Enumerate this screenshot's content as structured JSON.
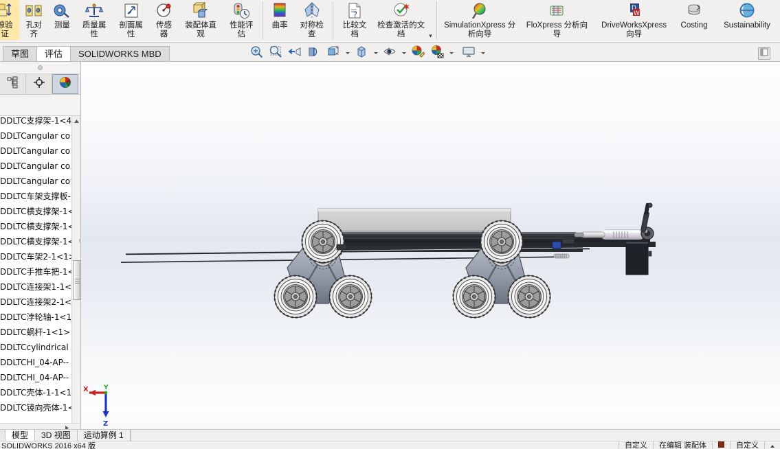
{
  "app": {
    "version_text": "SOLIDWORKS 2016 x64 版"
  },
  "ribbon": {
    "groups": [
      {
        "items": [
          {
            "label": "隙验证",
            "icon": "clearance-verification-icon",
            "truncated": true
          },
          {
            "label": "孔对齐",
            "icon": "hole-alignment-icon"
          },
          {
            "label": "测量",
            "icon": "measure-icon"
          },
          {
            "label": "质量属性",
            "icon": "mass-properties-icon"
          },
          {
            "label": "剖面属性",
            "icon": "section-properties-icon"
          },
          {
            "label": "传感器",
            "icon": "sensor-icon"
          },
          {
            "label": "装配体直观",
            "icon": "assembly-visualization-icon"
          },
          {
            "label": "性能评估",
            "icon": "performance-evaluation-icon"
          }
        ]
      },
      {
        "items": [
          {
            "label": "曲率",
            "icon": "curvature-icon"
          },
          {
            "label": "对称检查",
            "icon": "symmetry-check-icon"
          }
        ]
      },
      {
        "items": [
          {
            "label": "比较文档",
            "icon": "compare-documents-icon"
          },
          {
            "label": "检查激活的文档",
            "icon": "check-active-document-icon",
            "has_more": true
          }
        ]
      },
      {
        "items": [
          {
            "label": "SimulationXpress 分析向导",
            "icon": "simulationxpress-icon",
            "wide": true
          },
          {
            "label": "FloXpress 分析向导",
            "icon": "floxpress-icon",
            "wide": true
          },
          {
            "label": "DriveWorksXpress 向导",
            "icon": "driveworksxpress-icon",
            "wide": true
          },
          {
            "label": "Costing",
            "icon": "costing-icon",
            "wide": true
          },
          {
            "label": "Sustainability",
            "icon": "sustainability-icon",
            "wide": true
          }
        ]
      }
    ]
  },
  "command_tabs": [
    {
      "label": "草图",
      "active": false
    },
    {
      "label": "评估",
      "active": true
    },
    {
      "label": "SOLIDWORKS MBD",
      "active": false
    }
  ],
  "hud_toolbar": {
    "buttons": [
      {
        "name": "zoom-to-fit-icon",
        "caret": false
      },
      {
        "name": "zoom-to-area-icon",
        "caret": false
      },
      {
        "name": "previous-view-icon",
        "caret": false
      },
      {
        "name": "section-view-icon",
        "caret": false
      },
      {
        "name": "view-orientation-icon",
        "caret": false
      },
      {
        "name": "display-style-icon",
        "caret": true
      },
      {
        "name": "hide-show-items-icon",
        "caret": true
      },
      {
        "name": "edit-appearance-icon",
        "caret": false
      },
      {
        "name": "apply-scene-icon",
        "caret": true
      },
      {
        "name": "view-settings-icon",
        "caret": true
      }
    ],
    "collapse_panel": "collapse-panel-icon"
  },
  "left_panel": {
    "tabs": [
      {
        "name": "feature-manager-tab",
        "icon": "feature-tree-icon",
        "active": false
      },
      {
        "name": "property-manager-tab",
        "icon": "crosshair-icon",
        "active": false
      },
      {
        "name": "display-manager-tab",
        "icon": "color-sphere-icon",
        "active": true
      }
    ],
    "tree_nodes": [
      "DDLTC支撑架-1<4",
      "DDLTCangular co",
      "DDLTCangular co",
      "DDLTCangular co",
      "DDLTCangular co",
      "DDLTC车架支撑板-",
      "DDLTC横支撑架-1<",
      "DDLTC横支撑架-1<",
      "DDLTC横支撑架-1<",
      "DDLTC车架2-1<1>",
      "DDLTC手推车把-1<",
      "DDLTC连接架1-1<",
      "DDLTC连接架2-1<",
      "DDLTC浡轮轴-1<1",
      "DDLTC蜗杆-1<1>",
      "DDLTCcylindrical",
      "DDLTCHI_04-AP--",
      "DDLTCHI_04-AP--",
      "DDLTC壳体-1-1<1",
      "DDLTC镜向壳体-1<"
    ]
  },
  "viewport": {
    "triad": {
      "x_label": "X",
      "y_label": "Y",
      "z_label": "Z",
      "x_color": "#cc2222",
      "y_color": "#22aa22",
      "z_color": "#2233cc"
    },
    "model_name": "stair-climbing-trolley-assembly"
  },
  "bottom_tabs": [
    {
      "label": "模型",
      "active": true
    },
    {
      "label": "3D 视图",
      "active": false
    },
    {
      "label": "运动算例 1",
      "active": false
    }
  ],
  "status_bar": {
    "custom_left": "自定义",
    "editing": "在编辑 装配体",
    "custom_right": "自定义"
  },
  "colors": {
    "ribbon_bg": "#f1f0ee",
    "viewport_top": "#fdfdfe",
    "viewport_mid": "#e3e7ef",
    "accent_tab": "#ffffff",
    "tree_bg": "#ffffff"
  }
}
